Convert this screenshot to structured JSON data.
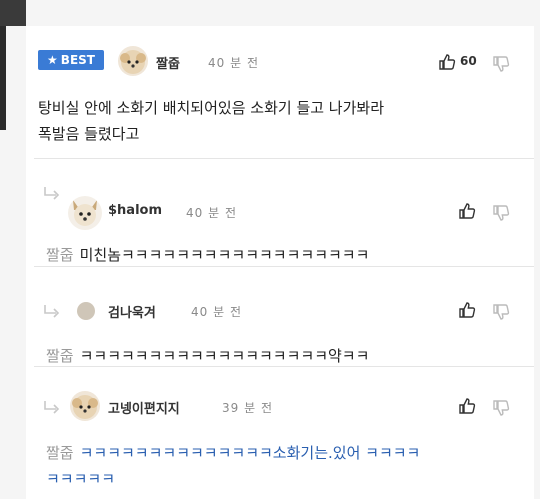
{
  "best_label": "BEST",
  "comments": [
    {
      "author": "짤줍",
      "time": "40 분 전",
      "likes": "60",
      "text_line1": "탕비실 안에 소화기 배치되어있음 소화기 들고 나가봐라",
      "text_line2": "폭발음 들렸다고"
    },
    {
      "author": "$halom",
      "time": "40 분 전",
      "mention": "짤줍",
      "text": "미친놈ㅋㅋㅋㅋㅋㅋㅋㅋㅋㅋㅋㅋㅋㅋㅋㅋㅋㅋ"
    },
    {
      "author": "검나욱겨",
      "time": "40 분 전",
      "mention": "짤줍",
      "text": "ㅋㅋㅋㅋㅋㅋㅋㅋㅋㅋㅋㅋㅋㅋㅋㅋㅋㅋ약ㅋㅋ"
    },
    {
      "author": "고넹이편지지",
      "time": "39 분 전",
      "mention": "짤줍",
      "text_line1": "ㅋㅋㅋㅋㅋㅋㅋㅋㅋㅋㅋㅋㅋㅋ소화기는.있어 ㅋㅋㅋㅋ",
      "text_line2": "ㅋㅋㅋㅋㅋ"
    }
  ],
  "colors": {
    "best_bg": "#3a7bd5",
    "reply_text": "#2a5fb0",
    "mention": "#9a9a9a"
  }
}
